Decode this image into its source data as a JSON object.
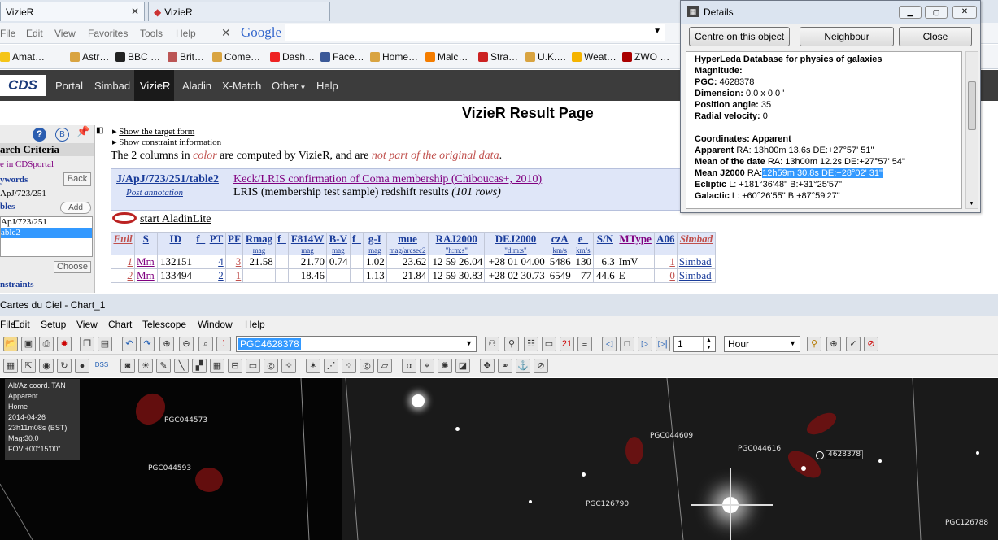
{
  "browser": {
    "tabs": [
      {
        "label": "VizieR"
      },
      {
        "label": "VizieR"
      }
    ],
    "menu": [
      "File",
      "Edit",
      "View",
      "Favorites",
      "Tools",
      "Help"
    ],
    "search_logo": "Google",
    "favorites": [
      "Amat…",
      "Astr…",
      "BBC …",
      "Brit…",
      "Come…",
      "Dash…",
      "Face…",
      "Home…",
      "Malc…",
      "Stra…",
      "U.K.…",
      "Weat…",
      "ZWO …"
    ]
  },
  "cds": {
    "logo": "CDS",
    "nav": [
      "Portal",
      "Simbad",
      "VizieR",
      "Aladin",
      "X-Match",
      "Other",
      "Help"
    ],
    "active": "VizieR"
  },
  "vizier": {
    "title": "VizieR Result Page",
    "show_target": "Show the target form",
    "show_constraint": "Show constraint information",
    "note_prefix": "The 2 columns in ",
    "note_color": "color",
    "note_mid": " are computed by VizieR, and are ",
    "note_notpart": "not part of the original data",
    "note_end": ".",
    "catalog_id": "J/ApJ/723/251/table2",
    "post_annotation": "Post annotation",
    "cat_title": "Keck/LRIS confirmation of Coma membership (Chiboucas+, 2010)",
    "cat_desc": "LRIS (membership test sample) redshift results",
    "cat_rows": "(101 rows)",
    "aladin": "start AladinLite",
    "headers": [
      "Full",
      "S",
      "ID",
      "f_",
      "PT",
      "PF",
      "Rmag",
      "f_",
      "F814W",
      "B-V",
      "f_",
      "g-I",
      "mue",
      "RAJ2000",
      "DEJ2000",
      "czA",
      "e_",
      "S/N",
      "MType",
      "A06",
      "Simbad"
    ],
    "units": [
      "",
      "",
      "",
      "",
      "",
      "",
      "mag",
      "",
      "mag",
      "mag",
      "",
      "mag",
      "mag/arcsec2",
      "\"h:m:s\"",
      "\"d:m:s\"",
      "km/s",
      "km/s",
      "",
      "",
      "",
      ""
    ],
    "rows": [
      [
        "1",
        "Mm",
        "132151",
        "",
        "4",
        "3",
        "21.58",
        "",
        "21.70",
        "0.74",
        "",
        "1.02",
        "23.62",
        "12 59 26.04",
        "+28 01 04.00",
        "5486",
        "130",
        "6.3",
        "ImV",
        "1",
        "Simbad"
      ],
      [
        "2",
        "Mm",
        "133494",
        "",
        "2",
        "1",
        "",
        "",
        "18.46",
        "",
        "",
        "1.13",
        "21.84",
        "12 59 30.83",
        "+28 02 30.73",
        "6549",
        "77",
        "44.6",
        "E",
        "0",
        "Simbad"
      ]
    ]
  },
  "sidebar": {
    "search_criteria": "arch Criteria",
    "in_cdsportal": "e in CDSportal",
    "keywords": "ywords",
    "back": "Back",
    "kw_value": "ApJ/723/251",
    "tables": "bles",
    "add": "Add",
    "list": [
      "ApJ/723/251",
      "able2"
    ],
    "choose": "Choose",
    "constraints": "nstraints"
  },
  "details": {
    "title": "Details",
    "btn_centre": "Centre on this object",
    "btn_neighbour": "Neighbour",
    "btn_close": "Close",
    "lines": [
      {
        "b": "HyperLeda Database for physics of galaxies",
        "t": ""
      },
      {
        "b": "Magnitude:",
        "t": ""
      },
      {
        "b": "PGC:",
        "t": "4628378"
      },
      {
        "b": "Dimension:",
        "t": "0.0 x 0.0 '"
      },
      {
        "b": "Position angle:",
        "t": "35"
      },
      {
        "b": "Radial velocity:",
        "t": "0"
      },
      {
        "b": "",
        "t": ""
      },
      {
        "b": "Coordinates: Apparent",
        "t": ""
      },
      {
        "b": "Apparent",
        "t": "RA: 13h00m 13.6s DE:+27°57' 51\""
      },
      {
        "b": "Mean of the date",
        "t": "RA: 13h00m 12.2s DE:+27°57' 54\""
      },
      {
        "b": "Mean J2000",
        "t": "RA:"
      },
      {
        "b": "Ecliptic",
        "t": "L: +181°36'48\" B:+31°25'57\""
      },
      {
        "b": "Galactic",
        "t": "L: +60°26'55\" B:+87°59'27\""
      }
    ],
    "highlight": "12h59m 30.8s DE:+28°02' 31\""
  },
  "cdc": {
    "title": "Cartes du Ciel - Chart_1",
    "menu": [
      "File",
      "Edit",
      "Setup",
      "View",
      "Chart",
      "Telescope",
      "Window",
      "Help"
    ],
    "search_value": "PGC4628378",
    "step_value": "1",
    "unit_value": "Hour",
    "info": [
      "Alt/Az coord. TAN",
      "Apparent",
      "Home",
      "2014-04-26",
      "23h11m08s (BST)",
      "Mag:30.0",
      "FOV:+00°15'00\""
    ],
    "labels": [
      "PGC044573",
      "PGC044593",
      "PGC044609",
      "PGC044616",
      "4628378",
      "PGC126790",
      "PGC126788"
    ]
  }
}
